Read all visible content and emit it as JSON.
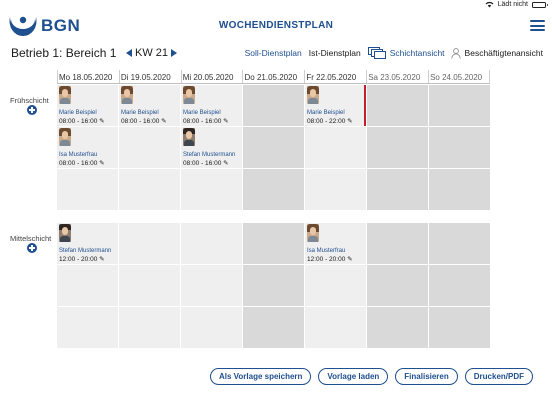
{
  "statusbar": {
    "status_text": "Lädt nicht"
  },
  "header": {
    "logo_text": "BGN",
    "title": "WOCHENDIENSTPLAN"
  },
  "toolbar": {
    "location": "Betrieb 1: Bereich 1",
    "week": "KW 21",
    "views": {
      "soll": "Soll-Dienstplan",
      "ist": "Ist-Dienstplan",
      "schicht": "Schichtansicht",
      "beschaeftigte": "Beschäftigtenansicht"
    }
  },
  "days": [
    "Mo 18.05.2020",
    "Di 19.05.2020",
    "Mi 20.05.2020",
    "Do 21.05.2020",
    "Fr 22.05.2020",
    "Sa 23.05.2020",
    "So 24.05.2020"
  ],
  "shifts": {
    "frueh": {
      "label": "Frühschicht",
      "assignments": [
        {
          "name": "Marie Beispiel",
          "time": "08:00 - 16:00 ✎"
        },
        {
          "name": "Marie Beispiel",
          "time": "08:00 - 16:00 ✎"
        },
        {
          "name": "Marie Beispiel",
          "time": "08:00 - 16:00 ✎"
        },
        {
          "name": "Marie Beispiel",
          "time": "08:00 - 22:00 ✎"
        },
        {
          "name": "Isa Musterfrau",
          "time": "08:00 - 16:00 ✎"
        },
        {
          "name": "Stefan Mustermann",
          "time": "08:00 - 16:00 ✎"
        }
      ]
    },
    "mittel": {
      "label": "Mittelschicht",
      "assignments": [
        {
          "name": "Stefan Mustermann",
          "time": "12:00 - 20:00 ✎"
        },
        {
          "name": "Isa Musterfrau",
          "time": "12:00 - 20:00 ✎"
        }
      ]
    }
  },
  "buttons": {
    "save_template": "Als Vorlage speichern",
    "load_template": "Vorlage laden",
    "finalize": "Finalisieren",
    "print": "Drucken/PDF"
  },
  "colors": {
    "brand": "#1e4f8f",
    "cell": "#efefef",
    "cell_weekend": "#d9d9d9",
    "marker": "#c41e2a"
  }
}
